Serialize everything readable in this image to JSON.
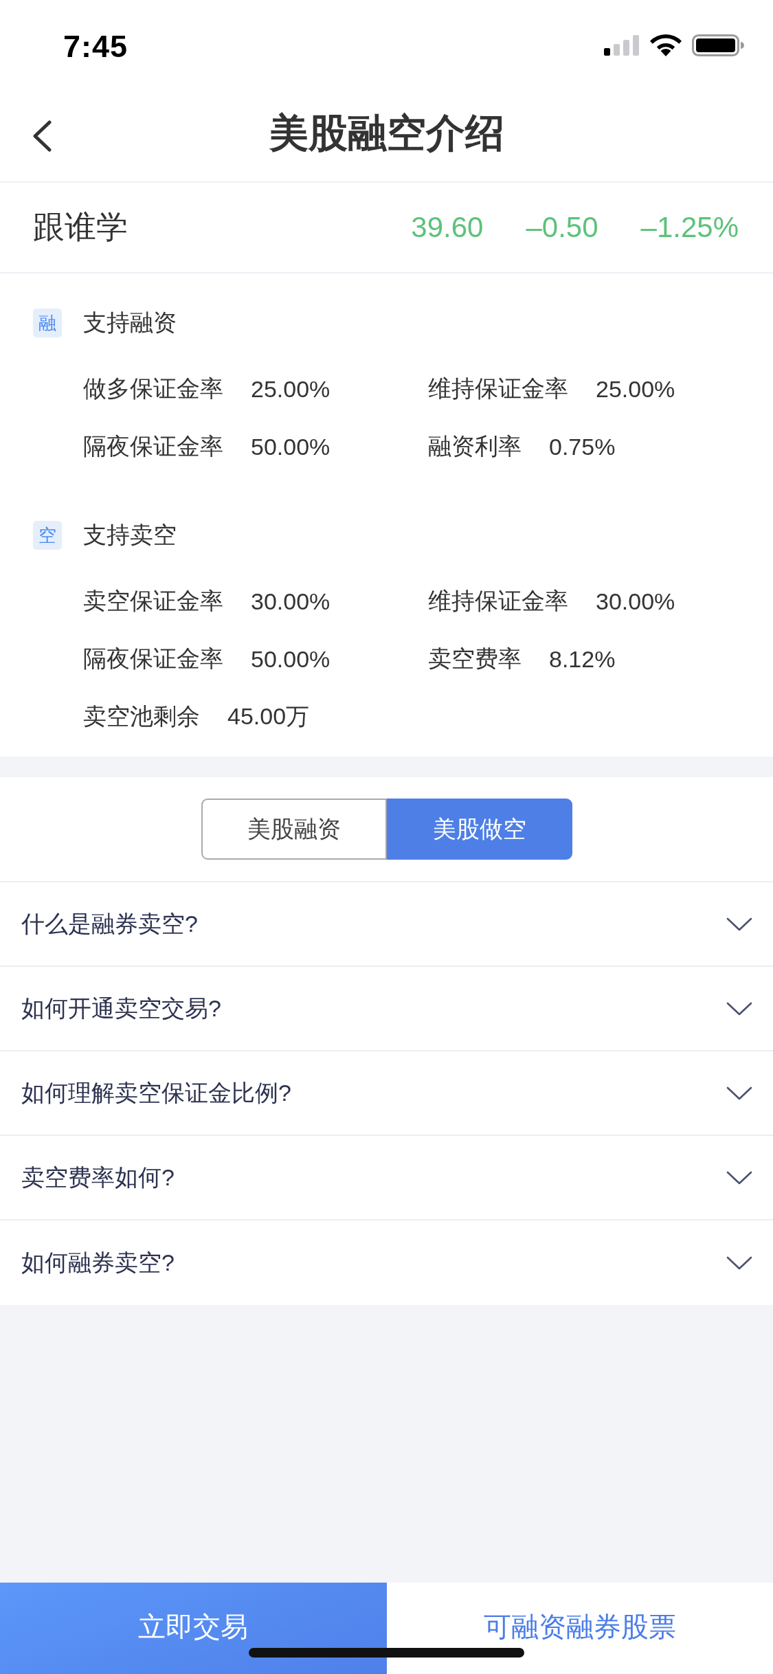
{
  "status_bar": {
    "time": "7:45"
  },
  "nav_bar": {
    "title": "美股融空介绍"
  },
  "quote": {
    "name": "跟谁学",
    "price": "39.60",
    "change": "–0.50",
    "change_percent": "–1.25%"
  },
  "sections": [
    {
      "badge": "融",
      "title": "支持融资",
      "items": [
        {
          "label": "做多保证金率",
          "value": "25.00%"
        },
        {
          "label": "维持保证金率",
          "value": "25.00%"
        },
        {
          "label": "隔夜保证金率",
          "value": "50.00%"
        },
        {
          "label": "融资利率",
          "value": "0.75%"
        }
      ]
    },
    {
      "badge": "空",
      "title": "支持卖空",
      "items": [
        {
          "label": "卖空保证金率",
          "value": "30.00%"
        },
        {
          "label": "维持保证金率",
          "value": "30.00%"
        },
        {
          "label": "隔夜保证金率",
          "value": "50.00%"
        },
        {
          "label": "卖空费率",
          "value": "8.12%"
        },
        {
          "label": "卖空池剩余",
          "value": "45.00万"
        }
      ]
    }
  ],
  "tabs": [
    {
      "label": "美股融资",
      "selected": false
    },
    {
      "label": "美股做空",
      "selected": true
    }
  ],
  "faq": [
    {
      "question": "什么是融券卖空?",
      "expanded": false
    },
    {
      "question": "如何开通卖空交易?",
      "expanded": false
    },
    {
      "question": "如何理解卖空保证金比例?",
      "expanded": false
    },
    {
      "question": "卖空费率如何?",
      "expanded": false
    },
    {
      "question": "如何融券卖空?",
      "expanded": false
    }
  ],
  "bottom_bar": {
    "buttons": [
      {
        "label": "立即交易",
        "kind": "primary"
      },
      {
        "label": "可融资融券股票",
        "kind": "secondary"
      }
    ]
  }
}
